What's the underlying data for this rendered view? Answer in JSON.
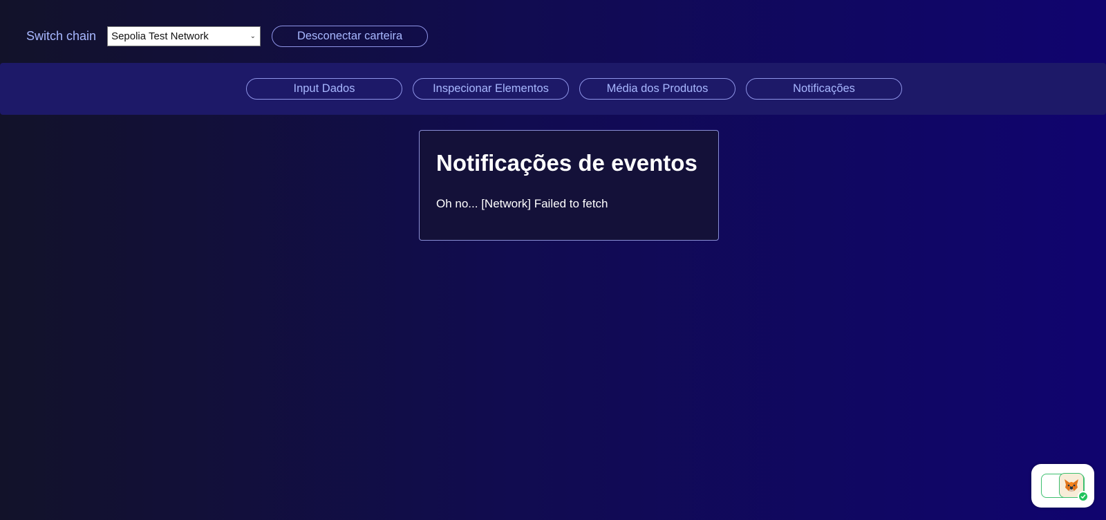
{
  "header": {
    "switch_chain_label": "Switch chain",
    "chain_select": {
      "selected": "Sepolia Test Network"
    },
    "disconnect_label": "Desconectar carteira"
  },
  "nav": {
    "tabs": [
      {
        "label": "Input Dados"
      },
      {
        "label": "Inspecionar Elementos"
      },
      {
        "label": "Média dos Produtos"
      },
      {
        "label": "Notificações"
      }
    ]
  },
  "card": {
    "title": "Notificações de eventos",
    "message": "Oh no... [Network] Failed to fetch"
  },
  "wallet_widget": {
    "icon": "metamask-fox-icon",
    "status_icon": "check-icon",
    "status_color": "#21c45d"
  },
  "colors": {
    "accent_text": "#a8b8ff",
    "nav_band": "#1d1968",
    "pill_border": "#8f95e8"
  }
}
